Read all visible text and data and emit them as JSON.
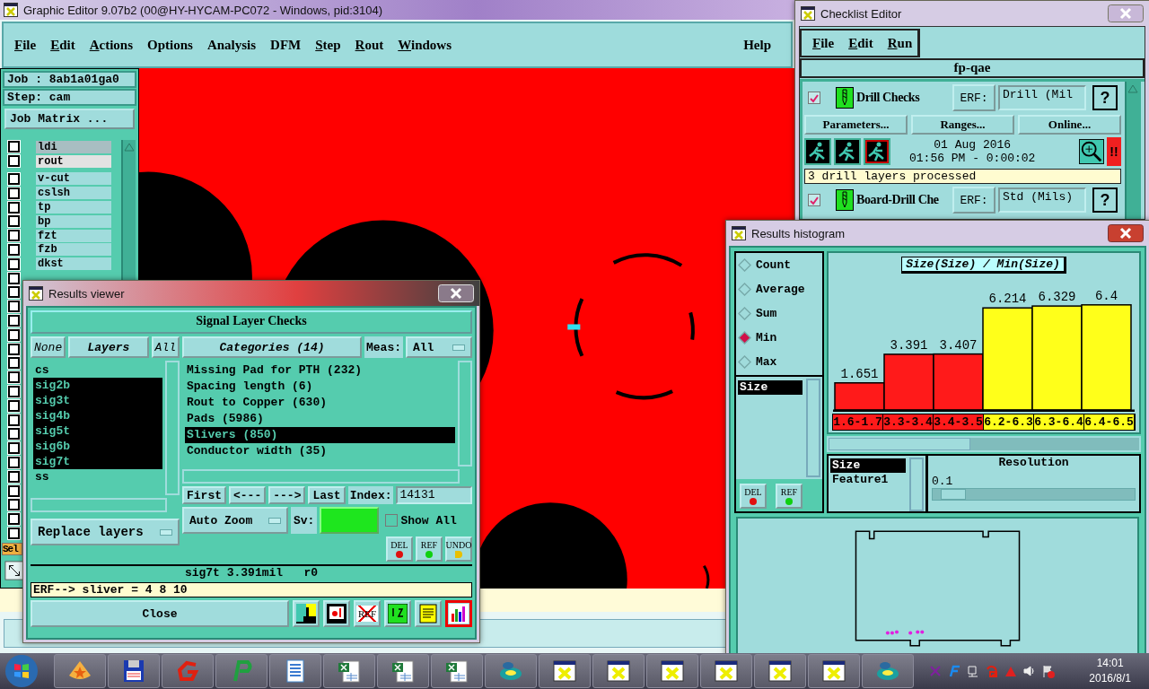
{
  "main_window": {
    "title": "Graphic Editor 9.07b2 (00@HY-HYCAM-PC072 - Windows, pid:3104)",
    "menu": [
      {
        "label": "File",
        "mnemonic": true
      },
      {
        "label": "Edit",
        "mnemonic": true
      },
      {
        "label": "Actions",
        "mnemonic": true
      },
      {
        "label": "Options",
        "mnemonic": false
      },
      {
        "label": "Analysis",
        "mnemonic": false
      },
      {
        "label": "DFM",
        "mnemonic": false
      },
      {
        "label": "Step",
        "mnemonic": true
      },
      {
        "label": "Rout",
        "mnemonic": true
      },
      {
        "label": "Windows",
        "mnemonic": true
      }
    ],
    "help": "Help",
    "job": "Job : 8ab1a01ga0",
    "step": "Step: cam",
    "job_matrix_button": "Job Matrix ...",
    "layer_groups": [
      [
        {
          "name": "ldi",
          "checked": false,
          "color": "#a8bec2"
        },
        {
          "name": "rout",
          "checked": false,
          "color": "#e2e2e2"
        }
      ],
      [
        {
          "name": "v-cut",
          "checked": false,
          "color": "#a0dcdc"
        },
        {
          "name": "cslsh",
          "checked": false,
          "color": "#a0dcdc"
        },
        {
          "name": "tp",
          "checked": false,
          "color": "#a0dcdc"
        },
        {
          "name": "bp",
          "checked": false,
          "color": "#a0dcdc"
        },
        {
          "name": "fzt",
          "checked": false,
          "color": "#a0dcdc"
        },
        {
          "name": "fzb",
          "checked": false,
          "color": "#a0dcdc"
        },
        {
          "name": "dkst",
          "checked": false,
          "color": "#a0dcdc"
        },
        {
          "checked": false
        },
        {
          "checked": false
        },
        {
          "checked": false
        },
        {
          "checked": false
        },
        {
          "checked": false
        },
        {
          "checked": false
        },
        {
          "checked": false
        },
        {
          "checked": false
        },
        {
          "checked": false
        },
        {
          "checked": false
        },
        {
          "checked": false
        },
        {
          "checked": false
        },
        {
          "checked": false
        },
        {
          "checked": false
        },
        {
          "checked": false
        },
        {
          "checked": false
        },
        {
          "checked": false
        },
        {
          "checked": false
        },
        {
          "checked": false
        }
      ]
    ],
    "select_button": "Sel"
  },
  "checklist_editor": {
    "title": "Checklist Editor",
    "menu": [
      {
        "label": "File",
        "mnemonic": true
      },
      {
        "label": "Edit",
        "mnemonic": true
      },
      {
        "label": "Run",
        "mnemonic": true
      }
    ],
    "checklist": "fp-qae",
    "actions": [
      {
        "name": "Drill Checks",
        "checked": true,
        "erf_label": "ERF:",
        "erf_value": "Drill (Mil",
        "help": "?",
        "buttons": [
          "Parameters...",
          "Ranges...",
          "Online..."
        ],
        "date": "01 Aug 2016",
        "time": "01:56 PM - 0:00:02",
        "status": "!!",
        "message": "3 drill layers processed"
      },
      {
        "name": "Board-Drill Che",
        "checked": true,
        "erf_label": "ERF:",
        "erf_value": "Std (Mils)",
        "help": "?"
      }
    ]
  },
  "results_viewer": {
    "title": "Results viewer",
    "header": "Signal Layer Checks",
    "none_button": "None",
    "layers_button": "Layers",
    "all_button": "All",
    "layers": [
      {
        "name": "cs",
        "selected": false
      },
      {
        "name": "sig2b",
        "selected": true
      },
      {
        "name": "sig3t",
        "selected": true
      },
      {
        "name": "sig4b",
        "selected": true
      },
      {
        "name": "sig5t",
        "selected": true
      },
      {
        "name": "sig6b",
        "selected": true
      },
      {
        "name": "sig7t",
        "selected": true
      },
      {
        "name": "ss",
        "selected": false
      }
    ],
    "categories_button": "Categories (14)",
    "meas_label": "Meas:",
    "meas_value": "All",
    "categories": [
      {
        "name": "Missing Pad for PTH (232)",
        "selected": false
      },
      {
        "name": "Spacing length (6)",
        "selected": false
      },
      {
        "name": "Rout to Copper (630)",
        "selected": false
      },
      {
        "name": "Pads (5986)",
        "selected": false
      },
      {
        "name": "Slivers (850)",
        "selected": true
      },
      {
        "name": "Conductor width (35)",
        "selected": false
      }
    ],
    "nav": [
      "First",
      "<---",
      "--->",
      "Last"
    ],
    "index_label": "Index:",
    "index_value": "14131",
    "zoom_mode": "Auto Zoom",
    "sv": {
      "label": "Sv:",
      "color": "#1ee61e"
    },
    "show_all": {
      "label": "Show All",
      "checked": false
    },
    "replace_layers": "Replace layers",
    "edit_buttons": [
      {
        "label": "DEL",
        "kind": "del"
      },
      {
        "label": "REF",
        "kind": "ref"
      },
      {
        "label": "UNDO",
        "kind": "undo"
      }
    ],
    "status": "sig7t 3.391mil   r0",
    "erf_line": "ERF--> sliver = 4 8 10",
    "close_button": "Close",
    "tools": [
      {
        "kind": "split",
        "selected": false
      },
      {
        "kind": "marker",
        "selected": false
      },
      {
        "kind": "ref_off",
        "label": "REF",
        "selected": false
      },
      {
        "kind": "numbers",
        "selected": false
      },
      {
        "kind": "report",
        "selected": false
      },
      {
        "kind": "histogram",
        "selected": true
      }
    ]
  },
  "results_histogram": {
    "title": "Results histogram",
    "modes": [
      {
        "label": "Count",
        "selected": false
      },
      {
        "label": "Average",
        "selected": false
      },
      {
        "label": "Sum",
        "selected": false
      },
      {
        "label": "Min",
        "selected": true
      },
      {
        "label": "Max",
        "selected": false
      }
    ],
    "attributes": [
      {
        "name": "Size",
        "selected": true
      }
    ],
    "side_buttons": [
      {
        "label": "DEL",
        "kind": "del"
      },
      {
        "label": "REF",
        "kind": "ref"
      }
    ],
    "chart_data": {
      "type": "bar",
      "title": "Size(Size) / Min(Size)",
      "categories": [
        "1.6-1.7",
        "3.3-3.4",
        "3.4-3.5",
        "6.2-6.3",
        "6.3-6.4",
        "6.4-6.5"
      ],
      "series": [
        {
          "color": "#ff1a1a",
          "values": [
            1.651,
            3.391,
            3.407,
            null,
            null,
            null
          ]
        },
        {
          "color": "#ffff1a",
          "values": [
            null,
            null,
            null,
            6.214,
            6.329,
            6.4
          ]
        }
      ],
      "data_labels": true
    },
    "fields": [
      {
        "name": "Size",
        "selected": true
      },
      {
        "name": "Feature1",
        "selected": false
      }
    ],
    "resolution": {
      "label": "Resolution",
      "value": "0.1",
      "level": 0.04
    }
  },
  "taskbar": {
    "time": "14:01",
    "date": "2016/8/1"
  }
}
